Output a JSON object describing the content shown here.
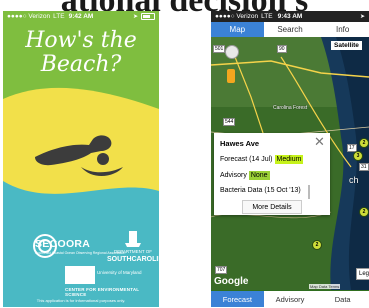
{
  "heading": {
    "text": "ational decision s"
  },
  "left_phone": {
    "status": {
      "carrier": "●●●●○ Verizon",
      "network": "LTE",
      "time": "9:42 AM"
    },
    "title_line1": "How's the",
    "title_line2": "Beach?",
    "logos": {
      "secoora": "SECOORA",
      "secoora_sub": "Southeast Coastal Ocean Observing Regional Association",
      "sc_dept": "DEPARTMENT OF",
      "sc_name": "SOUTHCAROLINA",
      "umd_name": "University of Maryland",
      "umd_center": "CENTER FOR ENVIRONMENTAL SCIENCE"
    },
    "disclaimer": "This application is for informational purposes only.",
    "colors": {
      "green": "#7fbe3f",
      "yellow": "#f2e04a",
      "teal": "#4ab9c4",
      "swimmer": "#3c3c3c"
    }
  },
  "right_phone": {
    "status": {
      "carrier": "●●●●○ Verizon",
      "network": "LTE",
      "time": "9:43 AM"
    },
    "tabs": [
      "Map",
      "Search",
      "Info"
    ],
    "active_tab": "Map",
    "map_type": "Satellite",
    "place_labels": [
      "Carolina Forest",
      "ch"
    ],
    "road_labels": [
      "501",
      "90",
      "544",
      "17",
      "31",
      "707"
    ],
    "popup": {
      "title": "Hawes Ave",
      "close": "✕",
      "forecast_label": "Forecast (14 Jul)",
      "forecast_value": "Medium",
      "advisory_label": "Advisory",
      "advisory_value": "None",
      "bacteria_label": "Bacteria Data (15 Oct '13)",
      "button": "More Details"
    },
    "markers": [
      "2",
      "3",
      "2",
      "2"
    ],
    "legend_label": "Leg",
    "google_label": "Google",
    "attribution": "Map Data   Terms",
    "bottom_tabs": [
      "Forecast",
      "Advisory",
      "Data"
    ],
    "active_bottom_tab": "Forecast",
    "colors": {
      "accent": "#3b82d6",
      "medium": "#c6f21b",
      "none": "#9bd136"
    }
  }
}
